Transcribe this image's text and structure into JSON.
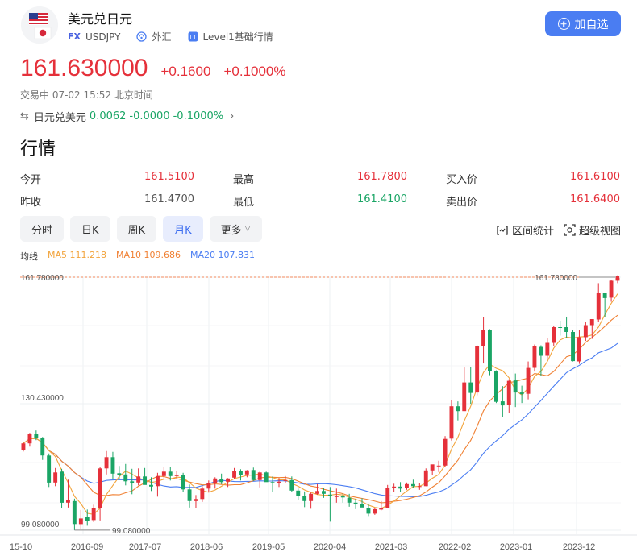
{
  "header": {
    "title": "美元兑日元",
    "market_tag": "FX",
    "code": "USDJPY",
    "category": "外汇",
    "level_tag": "L1",
    "level_label": "Level1基础行情",
    "add_label": "加自选"
  },
  "quote": {
    "price": "161.630000",
    "change": "+0.1600",
    "change_pct": "+0.1000%",
    "status": "交易中 07-02 15:52 北京时间",
    "cross_label": "日元兑美元",
    "cross_price": "0.0062",
    "cross_change": "-0.0000",
    "cross_pct": "-0.1000%"
  },
  "section_title": "行情",
  "stats": [
    [
      {
        "label": "今开",
        "value": "161.5100",
        "color": "red"
      },
      {
        "label": "最高",
        "value": "161.7800",
        "color": "red"
      },
      {
        "label": "买入价",
        "value": "161.6100",
        "color": "red"
      }
    ],
    [
      {
        "label": "昨收",
        "value": "161.4700",
        "color": "gray"
      },
      {
        "label": "最低",
        "value": "161.4100",
        "color": "green"
      },
      {
        "label": "卖出价",
        "value": "161.6400",
        "color": "red"
      }
    ]
  ],
  "tabs": [
    "分时",
    "日K",
    "周K",
    "月K",
    "更多"
  ],
  "active_tab": 3,
  "tools": {
    "range": "区间统计",
    "super": "超级视图"
  },
  "ma": {
    "label": "均线",
    "ma5": "MA5 111.218",
    "ma10": "MA10 109.686",
    "ma20": "MA20 107.831"
  },
  "colors": {
    "up": "#e5303a",
    "down": "#1aa565",
    "accent": "#4a7df2",
    "ma5": "#f2a33a",
    "ma10": "#f08033",
    "ma20": "#4a7df2"
  },
  "chart_data": {
    "type": "candlestick",
    "title": "",
    "ylim": [
      99.08,
      161.78
    ],
    "y_ticks": [
      "161.780000",
      "130.430000",
      "99.080000"
    ],
    "x_ticks": [
      "15-10",
      "2016-09",
      "2017-07",
      "2018-06",
      "2019-05",
      "2020-04",
      "2021-03",
      "2022-02",
      "2023-01",
      "2023-12"
    ],
    "high_marker": "161.780000",
    "low_marker": "99.080000",
    "ohlc": [
      [
        119.0,
        120.8,
        118.6,
        120.6
      ],
      [
        120.6,
        123.2,
        119.8,
        122.9
      ],
      [
        122.9,
        123.8,
        121.4,
        122.0
      ],
      [
        121.9,
        122.2,
        116.5,
        117.6
      ],
      [
        117.6,
        118.1,
        109.8,
        110.9
      ],
      [
        110.9,
        114.5,
        110.0,
        113.4
      ],
      [
        113.6,
        114.3,
        104.5,
        105.9
      ],
      [
        105.9,
        111.6,
        104.7,
        106.5
      ],
      [
        106.3,
        106.9,
        99.1,
        100.6
      ],
      [
        100.6,
        104.1,
        99.4,
        102.0
      ],
      [
        102.3,
        104.2,
        100.2,
        101.4
      ],
      [
        101.6,
        105.4,
        101.1,
        104.6
      ],
      [
        104.6,
        114.7,
        101.5,
        114.4
      ],
      [
        114.4,
        118.7,
        112.9,
        117.2
      ],
      [
        117.2,
        118.5,
        111.8,
        113.1
      ],
      [
        113.2,
        115.0,
        111.6,
        112.7
      ],
      [
        112.9,
        115.5,
        110.2,
        111.2
      ],
      [
        111.2,
        114.3,
        108.0,
        110.8
      ],
      [
        110.9,
        114.4,
        110.2,
        112.4
      ],
      [
        112.4,
        114.5,
        110.5,
        110.3
      ],
      [
        110.3,
        112.2,
        108.8,
        109.9
      ],
      [
        110.0,
        113.3,
        107.4,
        112.5
      ],
      [
        112.5,
        114.7,
        111.6,
        113.6
      ],
      [
        113.6,
        114.7,
        111.4,
        112.5
      ],
      [
        112.7,
        113.7,
        112.0,
        112.7
      ],
      [
        112.7,
        113.3,
        108.5,
        109.2
      ],
      [
        109.2,
        110.4,
        104.7,
        106.3
      ],
      [
        106.3,
        107.8,
        104.6,
        106.8
      ],
      [
        106.8,
        110.0,
        106.1,
        109.4
      ],
      [
        109.4,
        111.4,
        108.6,
        110.8
      ],
      [
        110.7,
        112.2,
        109.4,
        111.9
      ],
      [
        111.8,
        113.1,
        110.5,
        111.0
      ],
      [
        111.1,
        112.0,
        109.8,
        111.9
      ],
      [
        112.1,
        114.5,
        111.7,
        113.7
      ],
      [
        113.7,
        114.2,
        111.4,
        112.8
      ],
      [
        112.9,
        114.0,
        112.2,
        113.9
      ],
      [
        114.0,
        114.6,
        111.3,
        111.5
      ],
      [
        111.5,
        113.6,
        109.7,
        113.4
      ],
      [
        113.4,
        113.6,
        111.1,
        111.0
      ],
      [
        111.0,
        112.4,
        108.5,
        110.9
      ],
      [
        110.8,
        112.0,
        109.8,
        111.1
      ],
      [
        111.3,
        112.5,
        110.7,
        111.5
      ],
      [
        111.5,
        112.4,
        108.6,
        108.9
      ],
      [
        108.9,
        109.4,
        106.6,
        107.5
      ],
      [
        107.5,
        108.7,
        104.8,
        106.3
      ],
      [
        106.3,
        108.4,
        104.4,
        108.1
      ],
      [
        108.1,
        110.5,
        107.9,
        108.8
      ],
      [
        108.8,
        109.5,
        107.1,
        108.1
      ],
      [
        107.9,
        109.8,
        101.2,
        107.5
      ],
      [
        107.5,
        109.4,
        105.9,
        107.5
      ],
      [
        107.5,
        108.1,
        105.9,
        107.2
      ],
      [
        107.1,
        108.1,
        104.9,
        105.9
      ],
      [
        105.9,
        106.9,
        104.3,
        105.6
      ],
      [
        105.6,
        107.0,
        104.8,
        104.7
      ],
      [
        104.6,
        105.6,
        102.6,
        103.2
      ],
      [
        103.2,
        104.6,
        102.9,
        104.3
      ],
      [
        104.2,
        106.3,
        104.0,
        104.6
      ],
      [
        104.5,
        110.3,
        104.5,
        109.6
      ],
      [
        109.6,
        110.6,
        108.5,
        109.9
      ],
      [
        109.9,
        111.0,
        108.5,
        109.4
      ],
      [
        109.5,
        110.9,
        109.1,
        110.5
      ],
      [
        110.5,
        111.6,
        109.6,
        110.0
      ],
      [
        110.0,
        110.8,
        109.1,
        110.0
      ],
      [
        110.0,
        114.4,
        110.0,
        113.9
      ],
      [
        113.9,
        114.6,
        112.8,
        115.4
      ],
      [
        115.1,
        116.3,
        113.5,
        115.1
      ],
      [
        115.1,
        122.4,
        114.7,
        121.7
      ],
      [
        121.8,
        131.3,
        121.3,
        129.8
      ],
      [
        129.8,
        131.0,
        126.3,
        128.6
      ],
      [
        128.6,
        139.4,
        128.6,
        135.7
      ],
      [
        135.7,
        139.6,
        130.4,
        133.1
      ],
      [
        133.2,
        144.9,
        132.5,
        144.8
      ],
      [
        144.8,
        151.9,
        140.4,
        148.7
      ],
      [
        148.7,
        148.9,
        137.5,
        138.6
      ],
      [
        138.6,
        138.7,
        130.6,
        130.9
      ],
      [
        131.0,
        134.8,
        127.2,
        130.0
      ],
      [
        130.1,
        136.5,
        128.1,
        136.1
      ],
      [
        136.2,
        137.9,
        129.6,
        133.2
      ],
      [
        133.2,
        134.9,
        130.6,
        132.8
      ],
      [
        132.9,
        140.9,
        131.5,
        139.3
      ],
      [
        139.3,
        145.1,
        138.4,
        144.6
      ],
      [
        144.5,
        144.9,
        137.3,
        142.3
      ],
      [
        142.3,
        146.6,
        141.5,
        145.5
      ],
      [
        145.5,
        149.7,
        144.8,
        149.4
      ],
      [
        149.4,
        151.0,
        147.3,
        149.3
      ],
      [
        149.4,
        152.0,
        146.7,
        148.2
      ],
      [
        148.2,
        148.6,
        140.9,
        141.0
      ],
      [
        140.9,
        148.8,
        140.3,
        146.9
      ],
      [
        146.9,
        150.8,
        146.0,
        149.9
      ],
      [
        149.9,
        150.9,
        146.5,
        151.4
      ],
      [
        151.3,
        160.3,
        150.8,
        157.8
      ],
      [
        157.8,
        157.9,
        151.9,
        156.6
      ],
      [
        156.7,
        161.1,
        155.7,
        160.9
      ],
      [
        160.9,
        161.8,
        160.3,
        161.6
      ]
    ]
  }
}
